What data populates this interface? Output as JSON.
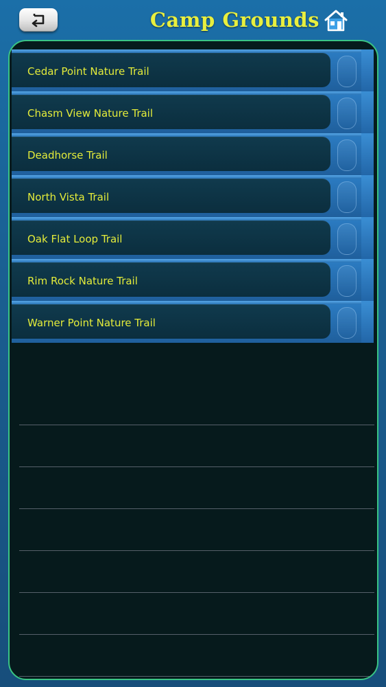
{
  "header": {
    "title": "Camp Grounds",
    "back_icon": "return-arrow-icon",
    "home_icon": "house-icon"
  },
  "colors": {
    "title": "#e8ef3f",
    "item_text": "#e4ec3a",
    "panel_border": "#3ac485",
    "row_blue": "#2c7dc4",
    "background": "#1b6fa8"
  },
  "trails": [
    {
      "label": "Cedar Point Nature Trail"
    },
    {
      "label": "Chasm View Nature Trail"
    },
    {
      "label": "Deadhorse Trail"
    },
    {
      "label": "North Vista Trail"
    },
    {
      "label": "Oak Flat Loop Trail"
    },
    {
      "label": "Rim Rock Nature Trail"
    },
    {
      "label": "Warner Point Nature Trail"
    }
  ]
}
